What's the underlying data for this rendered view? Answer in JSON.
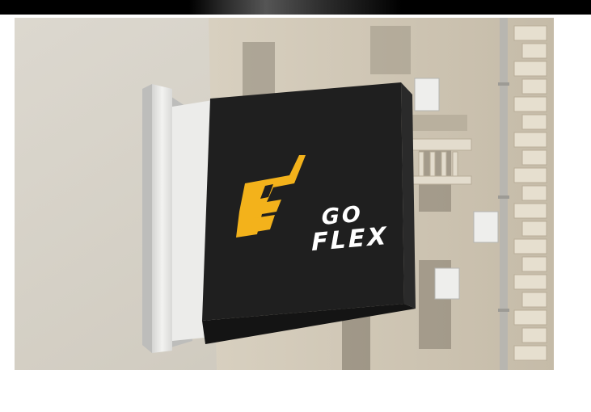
{
  "image": {
    "subject": "hanging-square-shop-sign-mockup",
    "sign": {
      "brand_line1": "GO",
      "brand_line2": "FLEX",
      "logo_letter": "F",
      "colors": {
        "sign_face": "#1f1f1f",
        "logo_accent": "#f3b21b",
        "text": "#ffffff",
        "bracket": "#e9e9e7",
        "wall": "#d6d1c6",
        "building": "#cfc6b4"
      }
    }
  }
}
